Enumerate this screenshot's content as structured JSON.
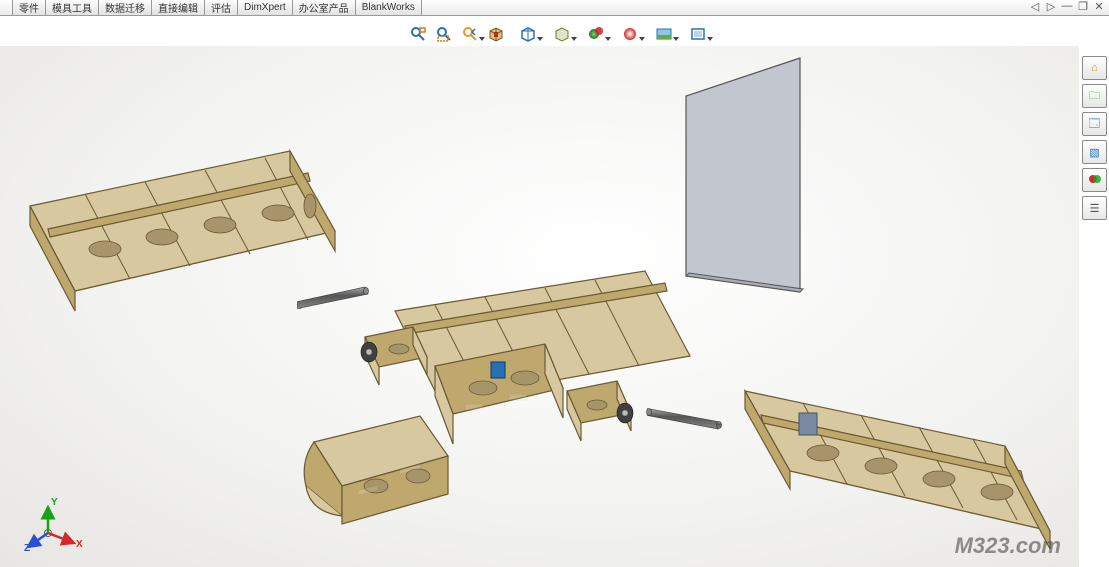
{
  "tabs": [
    "零件",
    "模具工具",
    "数据迁移",
    "直接编辑",
    "评估",
    "DimXpert",
    "办公室产品",
    "BlankWorks"
  ],
  "window_controls": {
    "back": "◁",
    "fwd": "▷",
    "min": "—",
    "max": "❐",
    "close": "✕"
  },
  "view_toolbar": {
    "zoom_fit": "zoom-to-fit-icon",
    "zoom_area": "zoom-to-area-icon",
    "prev_view": "previous-view-icon",
    "section": "section-view-icon",
    "view_orient": "view-orientation-icon",
    "display_style": "display-style-icon",
    "hide_show": "hide-show-items-icon",
    "edit_appearance": "edit-appearance-icon",
    "apply_scene": "apply-scene-icon",
    "view_settings": "view-settings-icon"
  },
  "right_tabs": [
    "home",
    "resources",
    "view-palette",
    "appearances",
    "properties",
    "render"
  ],
  "triad": {
    "x": "X",
    "y": "Y",
    "z": "Z"
  },
  "watermark": "M323.com",
  "icon_glyphs": {
    "home": "⌂",
    "resources": "📦",
    "view-palette": "🗔",
    "appearances": "🟢",
    "properties": "⚙",
    "render": "🎬"
  },
  "colors": {
    "plywood": "#d8c8a0",
    "plywood_edge": "#6a5a32",
    "fin": "#c2c6cf",
    "rod": "#6b6b6b"
  }
}
